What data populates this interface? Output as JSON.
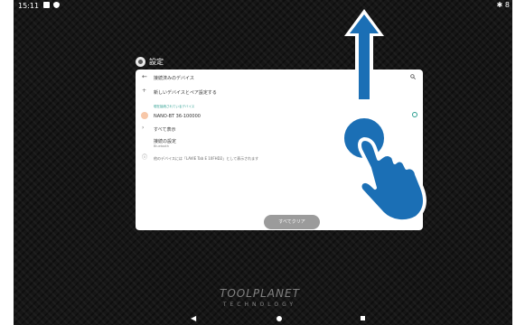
{
  "status_bar": {
    "time": "15:11",
    "right": "✱ 8"
  },
  "settings": {
    "title": "設定"
  },
  "panel": {
    "title": "接続済みのデバイス",
    "pair_new": "新しいデバイスとペア設定する",
    "section_label": "現在接続されているデバイス",
    "device_name": "NANO-BT 36-100000",
    "see_all": "すべて表示",
    "connection_prefs": "接続の設定",
    "connection_sub": "Bluetooth",
    "info": "他のデバイスには「LAVIE Tab E 10FHD2」として表示されます",
    "clear_button": "すべてクリア"
  },
  "brand": {
    "main": "TOOLPLANET",
    "sub": "TECHNOLOGY"
  },
  "colors": {
    "accent": "#2a9d8f",
    "gesture": "#1b6fb5"
  }
}
